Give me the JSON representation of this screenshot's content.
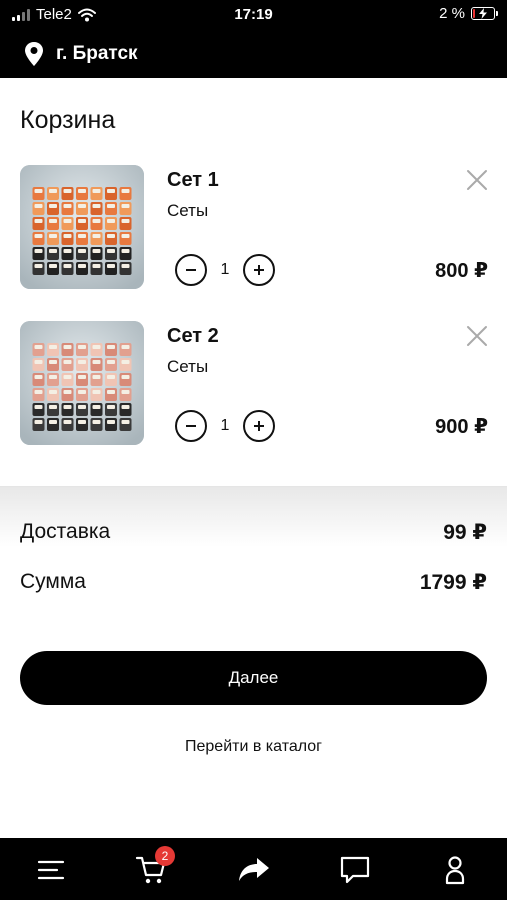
{
  "status_bar": {
    "carrier": "Tele2",
    "time": "17:19",
    "battery_text": "2 %",
    "battery_level_percent": 2
  },
  "header": {
    "city": "г. Братск",
    "location_icon": "location-pin-icon"
  },
  "page_title": "Корзина",
  "cart": {
    "items": [
      {
        "name": "Сет 1",
        "category": "Сеты",
        "quantity": "1",
        "price": "800 ₽"
      },
      {
        "name": "Сет 2",
        "category": "Сеты",
        "quantity": "1",
        "price": "900 ₽"
      }
    ]
  },
  "summary": {
    "delivery_label": "Доставка",
    "delivery_value": "99 ₽",
    "total_label": "Сумма",
    "total_value": "1799 ₽"
  },
  "actions": {
    "next_label": "Далее",
    "catalog_label": "Перейти в каталог"
  },
  "tab_bar": {
    "cart_badge": "2",
    "icons": [
      "menu-icon",
      "cart-icon",
      "share-icon",
      "chat-icon",
      "profile-icon"
    ]
  },
  "colors": {
    "header_bg": "#000000",
    "badge": "#e53935",
    "button_bg": "#000000"
  }
}
